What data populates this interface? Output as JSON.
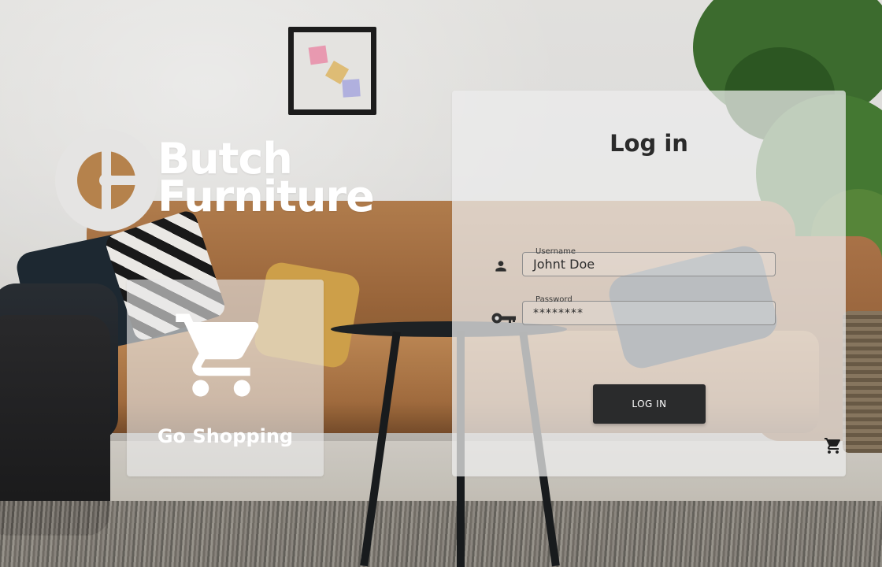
{
  "brand": {
    "line1": "Butch",
    "line2": "Furniture",
    "logo_icon": "circle-cross-logo-icon",
    "logo_color": "#b5824c"
  },
  "shop_card": {
    "icon": "shopping-cart-icon",
    "label": "Go Shopping"
  },
  "login": {
    "title": "Log in",
    "username": {
      "icon": "person-icon",
      "label": "Username",
      "value": "Johnt Doe"
    },
    "password": {
      "icon": "key-icon",
      "label": "Password",
      "value": "********"
    },
    "button_label": "LOG IN",
    "cart_icon": "shopping-cart-icon"
  },
  "colors": {
    "button_bg": "#2a2b2c",
    "panel_bg": "#ececec",
    "text_dark": "#2b2b2b",
    "text_light": "#ffffff"
  }
}
